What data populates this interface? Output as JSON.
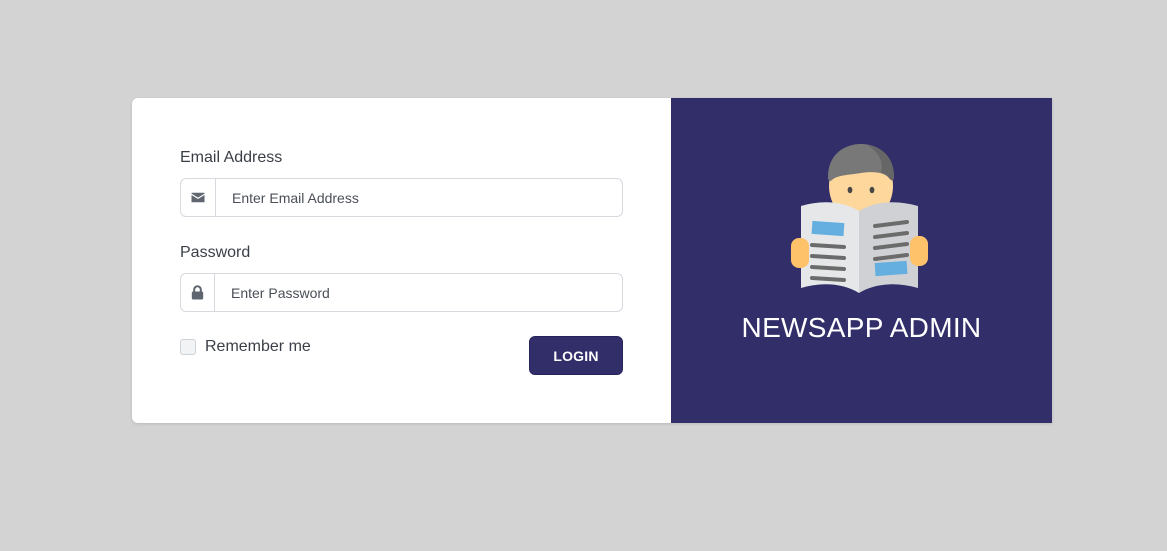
{
  "login": {
    "email_label": "Email Address",
    "email_placeholder": "Enter Email Address",
    "email_value": "",
    "password_label": "Password",
    "password_placeholder": "Enter Password",
    "password_value": "",
    "remember_label": "Remember me",
    "remember_checked": false,
    "login_button": "LOGIN"
  },
  "brand": {
    "title": "NEWSAPP ADMIN"
  },
  "icons": {
    "email": "envelope-icon",
    "password": "lock-icon",
    "logo": "newspaper-reader-icon"
  },
  "colors": {
    "background": "#d3d3d3",
    "brand_panel": "#312e69",
    "button": "#312e69",
    "card": "#ffffff"
  }
}
